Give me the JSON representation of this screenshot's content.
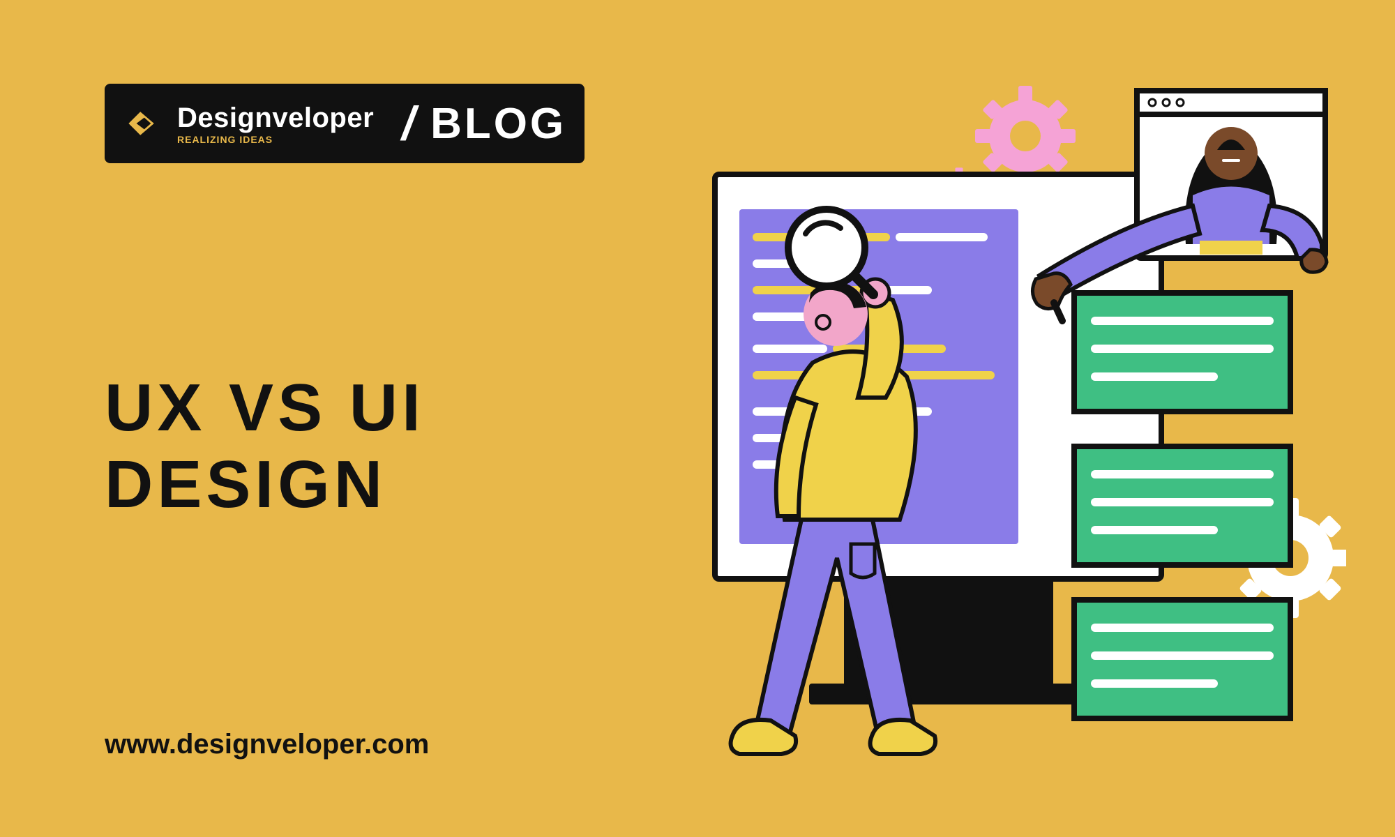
{
  "brand": {
    "name": "Designveloper",
    "tagline": "REALIZING IDEAS",
    "slash": "/",
    "blog": "BLOG"
  },
  "headline_line1": "UX VS UI",
  "headline_line2": "DESIGN",
  "url": "www.designveloper.com",
  "colors": {
    "bg": "#e8b84a",
    "dark": "#111111",
    "purple": "#8a7ce8",
    "green": "#3fbf83",
    "pink": "#f5a3d6",
    "skin": "#7a4a2a"
  }
}
